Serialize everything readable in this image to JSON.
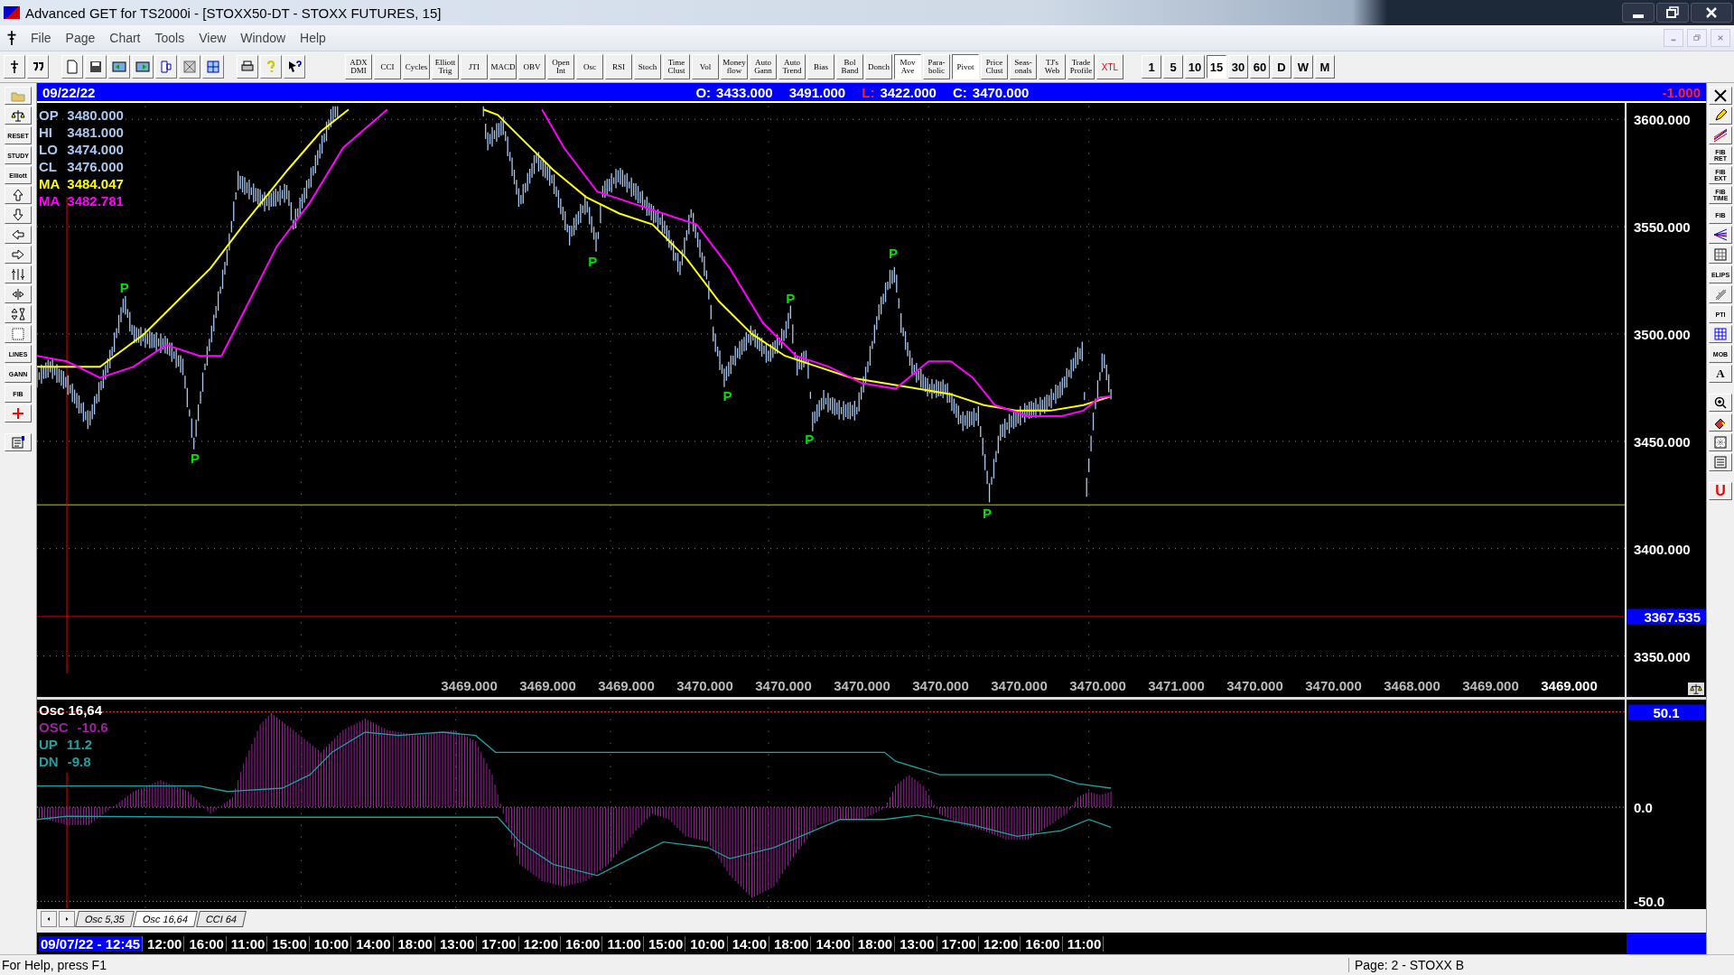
{
  "window": {
    "title": "Advanced GET for TS2000i - [STOXX50-DT - STOXX FUTURES, 15]"
  },
  "menu": [
    "File",
    "Page",
    "Chart",
    "Tools",
    "View",
    "Window",
    "Help"
  ],
  "study_buttons": [
    {
      "label": "ADX DMI",
      "selected": false
    },
    {
      "label": "CCI",
      "selected": false
    },
    {
      "label": "Cycles",
      "selected": false
    },
    {
      "label": "Elliott Trig",
      "selected": false
    },
    {
      "label": "JTI",
      "selected": false
    },
    {
      "label": "MACD",
      "selected": false
    },
    {
      "label": "OBV",
      "selected": false
    },
    {
      "label": "Open Int",
      "selected": false
    },
    {
      "label": "Osc",
      "selected": false
    },
    {
      "label": "RSI",
      "selected": false
    },
    {
      "label": "Stoch",
      "selected": false
    },
    {
      "label": "Time Clust",
      "selected": false
    },
    {
      "label": "Vol",
      "selected": false
    },
    {
      "label": "Money flow",
      "selected": false
    },
    {
      "label": "Auto Gann",
      "selected": false
    },
    {
      "label": "Auto Trend",
      "selected": false
    },
    {
      "label": "Bias",
      "selected": false
    },
    {
      "label": "Bol Band",
      "selected": false
    },
    {
      "label": "Donch",
      "selected": false
    },
    {
      "label": "Mov Ave",
      "selected": true
    },
    {
      "label": "Para-bolic",
      "selected": false
    },
    {
      "label": "Pivot",
      "selected": true
    },
    {
      "label": "Price Clust",
      "selected": false
    },
    {
      "label": "Seas-onals",
      "selected": false
    },
    {
      "label": "TJ's Web",
      "selected": false
    },
    {
      "label": "Trade Profile",
      "selected": false
    },
    {
      "label": "XTL",
      "selected": false
    }
  ],
  "interval_buttons": [
    {
      "label": "1",
      "selected": false
    },
    {
      "label": "5",
      "selected": false
    },
    {
      "label": "10",
      "selected": false
    },
    {
      "label": "15",
      "selected": true
    },
    {
      "label": "30",
      "selected": false
    },
    {
      "label": "60",
      "selected": false
    },
    {
      "label": "D",
      "selected": false
    },
    {
      "label": "W",
      "selected": false
    },
    {
      "label": "M",
      "selected": false
    }
  ],
  "chart_header": {
    "date": "09/22/22",
    "quotes": [
      {
        "label": "O:",
        "value": "3433.000",
        "emphasized": false
      },
      {
        "value": "3491.000"
      },
      {
        "label": "L:",
        "value": "3422.000",
        "emphasized": true
      },
      {
        "label": "C:",
        "value": "3470.000",
        "emphasized": false
      }
    ],
    "change": "-1.000"
  },
  "legend": [
    {
      "label": "OP",
      "value": "3480.000",
      "color": "#a8c8f0"
    },
    {
      "label": "HI",
      "value": "3481.000",
      "color": "#a8c8f0"
    },
    {
      "label": "LO",
      "value": "3474.000",
      "color": "#a8c8f0"
    },
    {
      "label": "CL",
      "value": "3476.000",
      "color": "#a8c8f0"
    },
    {
      "label": "MA",
      "value": "3484.047",
      "color": "#ffff00"
    },
    {
      "label": "MA",
      "value": "3482.781",
      "color": "#ff00ff"
    }
  ],
  "pivot_markers": [
    {
      "label": "P"
    },
    {
      "label": "P"
    },
    {
      "label": "P"
    },
    {
      "label": "P"
    },
    {
      "label": "P"
    },
    {
      "label": "P"
    },
    {
      "label": "P"
    },
    {
      "label": "P"
    }
  ],
  "price_axis": [
    "3600.000",
    "3550.000",
    "3500.000",
    "3450.000",
    "3400.000",
    "3350.000"
  ],
  "price_marker": "3367.535",
  "bar_values": [
    {
      "value": "3469.000",
      "current": false
    },
    {
      "value": "3469.000",
      "current": false
    },
    {
      "value": "3469.000",
      "current": false
    },
    {
      "value": "3470.000",
      "current": false
    },
    {
      "value": "3470.000",
      "current": false
    },
    {
      "value": "3470.000",
      "current": false
    },
    {
      "value": "3470.000",
      "current": false
    },
    {
      "value": "3470.000",
      "current": false
    },
    {
      "value": "3470.000",
      "current": false
    },
    {
      "value": "3471.000",
      "current": false
    },
    {
      "value": "3470.000",
      "current": false
    },
    {
      "value": "3470.000",
      "current": false
    },
    {
      "value": "3468.000",
      "current": false
    },
    {
      "value": "3469.000",
      "current": false
    },
    {
      "value": "3469.000",
      "current": true
    }
  ],
  "oscillator": {
    "title": "Osc 16,64",
    "legend": [
      {
        "label": "OSC",
        "value": "-10.6",
        "color": "#a020a0"
      },
      {
        "label": "UP",
        "value": "11.2",
        "color": "#20a0a0"
      },
      {
        "label": "DN",
        "value": "-9.8",
        "color": "#20a0a0"
      }
    ],
    "marker": "50.1",
    "axis": [
      "0.0",
      "-50.0"
    ]
  },
  "study_tabs": [
    {
      "label": "Osc 5,35",
      "selected": false
    },
    {
      "label": "Osc 16,64",
      "selected": true
    },
    {
      "label": "CCI 64",
      "selected": false
    }
  ],
  "time_axis": [
    {
      "label": "09/07/22 - 12:45",
      "selected": true
    },
    {
      "label": "12:00",
      "selected": false
    },
    {
      "label": "16:00",
      "selected": false
    },
    {
      "label": "11:00",
      "selected": false
    },
    {
      "label": "15:00",
      "selected": false
    },
    {
      "label": "10:00",
      "selected": false
    },
    {
      "label": "14:00",
      "selected": false
    },
    {
      "label": "18:00",
      "selected": false
    },
    {
      "label": "13:00",
      "selected": false
    },
    {
      "label": "17:00",
      "selected": false
    },
    {
      "label": "12:00",
      "selected": false
    },
    {
      "label": "16:00",
      "selected": false
    },
    {
      "label": "11:00",
      "selected": false
    },
    {
      "label": "15:00",
      "selected": false
    },
    {
      "label": "10:00",
      "selected": false
    },
    {
      "label": "14:00",
      "selected": false
    },
    {
      "label": "18:00",
      "selected": false
    },
    {
      "label": "14:00",
      "selected": false
    },
    {
      "label": "18:00",
      "selected": false
    },
    {
      "label": "13:00",
      "selected": false
    },
    {
      "label": "17:00",
      "selected": false
    },
    {
      "label": "12:00",
      "selected": false
    },
    {
      "label": "16:00",
      "selected": false
    },
    {
      "label": "11:00",
      "selected": false
    }
  ],
  "left_toolbar": [
    "RESET",
    "STUDY",
    "Elliott",
    "LINES",
    "GANN",
    "FIB"
  ],
  "right_toolbar": [
    "FIB RET",
    "FIB EXT",
    "FIB TIME",
    "FIB",
    "ELIPS",
    "PTI",
    "MOB",
    "A",
    "U"
  ],
  "status_bar": {
    "help": "For Help, press F1",
    "page": "Page: 2 - STOXX B"
  }
}
